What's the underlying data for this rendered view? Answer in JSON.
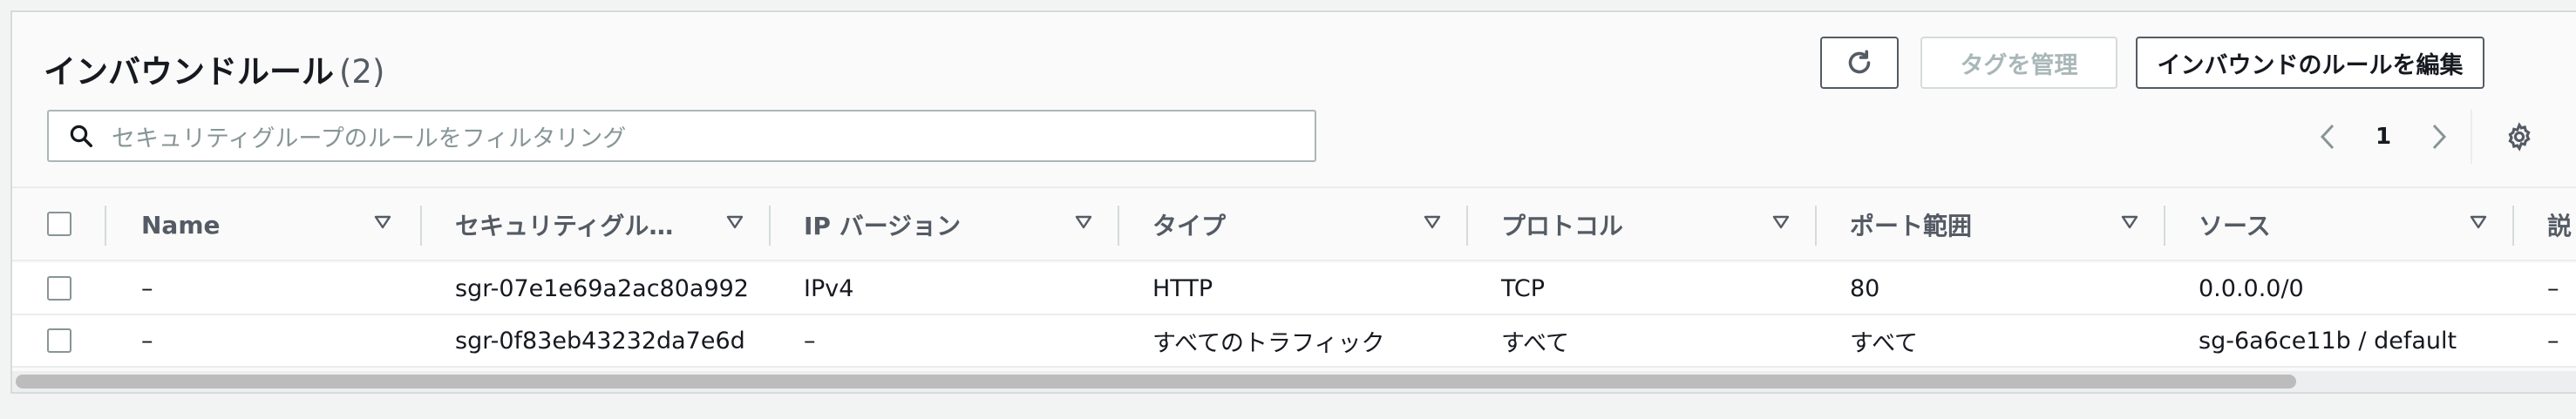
{
  "header": {
    "title": "インバウンドルール",
    "count": "(2)"
  },
  "toolbar": {
    "refresh_icon": "refresh-icon",
    "manage_tags_label": "タグを管理",
    "edit_inbound_label": "インバウンドのルールを編集"
  },
  "search": {
    "placeholder": "セキュリティグループのルールをフィルタリング"
  },
  "pagination": {
    "current_page": "1"
  },
  "table": {
    "columns": [
      {
        "label": "Name"
      },
      {
        "label": "セキュリティグル…"
      },
      {
        "label": "IP バージョン"
      },
      {
        "label": "タイプ"
      },
      {
        "label": "プロトコル"
      },
      {
        "label": "ポート範囲"
      },
      {
        "label": "ソース"
      },
      {
        "label": "説"
      }
    ],
    "rows": [
      {
        "name": "–",
        "sgr_id": "sgr-07e1e69a2ac80a992",
        "ip_version": "IPv4",
        "type": "HTTP",
        "protocol": "TCP",
        "port_range": "80",
        "source": "0.0.0.0/0",
        "description": "–"
      },
      {
        "name": "–",
        "sgr_id": "sgr-0f83eb43232da7e6d",
        "ip_version": "–",
        "type": "すべてのトラフィック",
        "protocol": "すべて",
        "port_range": "すべて",
        "source": "sg-6a6ce11b / default",
        "description": "–"
      }
    ]
  },
  "colors": {
    "text": "#16191f",
    "muted": "#545b64",
    "disabled": "#aab7b8",
    "border": "#eaeded"
  }
}
